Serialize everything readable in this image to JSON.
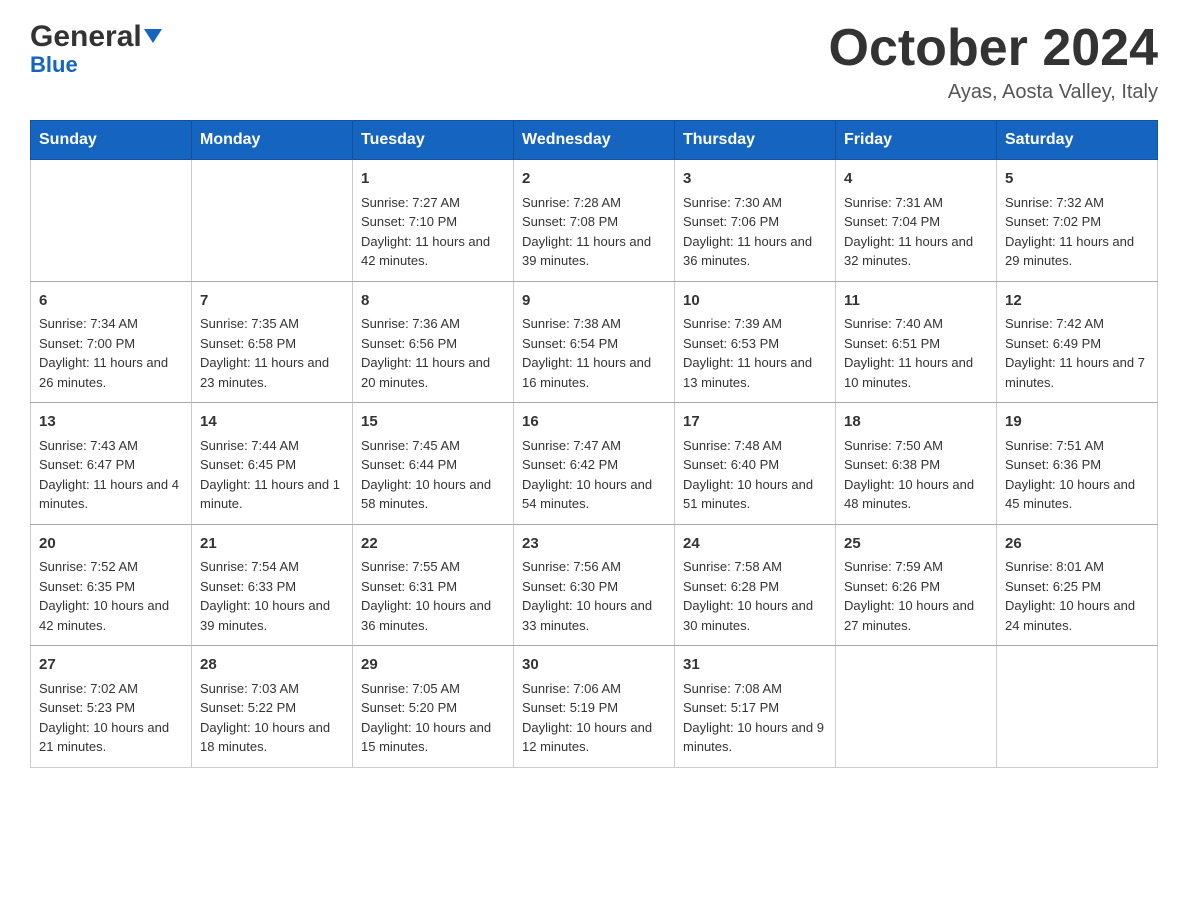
{
  "header": {
    "logo_general": "General",
    "logo_blue": "Blue",
    "month_year": "October 2024",
    "location": "Ayas, Aosta Valley, Italy"
  },
  "days_of_week": [
    "Sunday",
    "Monday",
    "Tuesday",
    "Wednesday",
    "Thursday",
    "Friday",
    "Saturday"
  ],
  "weeks": [
    [
      {
        "day": "",
        "sunrise": "",
        "sunset": "",
        "daylight": ""
      },
      {
        "day": "",
        "sunrise": "",
        "sunset": "",
        "daylight": ""
      },
      {
        "day": "1",
        "sunrise": "Sunrise: 7:27 AM",
        "sunset": "Sunset: 7:10 PM",
        "daylight": "Daylight: 11 hours and 42 minutes."
      },
      {
        "day": "2",
        "sunrise": "Sunrise: 7:28 AM",
        "sunset": "Sunset: 7:08 PM",
        "daylight": "Daylight: 11 hours and 39 minutes."
      },
      {
        "day": "3",
        "sunrise": "Sunrise: 7:30 AM",
        "sunset": "Sunset: 7:06 PM",
        "daylight": "Daylight: 11 hours and 36 minutes."
      },
      {
        "day": "4",
        "sunrise": "Sunrise: 7:31 AM",
        "sunset": "Sunset: 7:04 PM",
        "daylight": "Daylight: 11 hours and 32 minutes."
      },
      {
        "day": "5",
        "sunrise": "Sunrise: 7:32 AM",
        "sunset": "Sunset: 7:02 PM",
        "daylight": "Daylight: 11 hours and 29 minutes."
      }
    ],
    [
      {
        "day": "6",
        "sunrise": "Sunrise: 7:34 AM",
        "sunset": "Sunset: 7:00 PM",
        "daylight": "Daylight: 11 hours and 26 minutes."
      },
      {
        "day": "7",
        "sunrise": "Sunrise: 7:35 AM",
        "sunset": "Sunset: 6:58 PM",
        "daylight": "Daylight: 11 hours and 23 minutes."
      },
      {
        "day": "8",
        "sunrise": "Sunrise: 7:36 AM",
        "sunset": "Sunset: 6:56 PM",
        "daylight": "Daylight: 11 hours and 20 minutes."
      },
      {
        "day": "9",
        "sunrise": "Sunrise: 7:38 AM",
        "sunset": "Sunset: 6:54 PM",
        "daylight": "Daylight: 11 hours and 16 minutes."
      },
      {
        "day": "10",
        "sunrise": "Sunrise: 7:39 AM",
        "sunset": "Sunset: 6:53 PM",
        "daylight": "Daylight: 11 hours and 13 minutes."
      },
      {
        "day": "11",
        "sunrise": "Sunrise: 7:40 AM",
        "sunset": "Sunset: 6:51 PM",
        "daylight": "Daylight: 11 hours and 10 minutes."
      },
      {
        "day": "12",
        "sunrise": "Sunrise: 7:42 AM",
        "sunset": "Sunset: 6:49 PM",
        "daylight": "Daylight: 11 hours and 7 minutes."
      }
    ],
    [
      {
        "day": "13",
        "sunrise": "Sunrise: 7:43 AM",
        "sunset": "Sunset: 6:47 PM",
        "daylight": "Daylight: 11 hours and 4 minutes."
      },
      {
        "day": "14",
        "sunrise": "Sunrise: 7:44 AM",
        "sunset": "Sunset: 6:45 PM",
        "daylight": "Daylight: 11 hours and 1 minute."
      },
      {
        "day": "15",
        "sunrise": "Sunrise: 7:45 AM",
        "sunset": "Sunset: 6:44 PM",
        "daylight": "Daylight: 10 hours and 58 minutes."
      },
      {
        "day": "16",
        "sunrise": "Sunrise: 7:47 AM",
        "sunset": "Sunset: 6:42 PM",
        "daylight": "Daylight: 10 hours and 54 minutes."
      },
      {
        "day": "17",
        "sunrise": "Sunrise: 7:48 AM",
        "sunset": "Sunset: 6:40 PM",
        "daylight": "Daylight: 10 hours and 51 minutes."
      },
      {
        "day": "18",
        "sunrise": "Sunrise: 7:50 AM",
        "sunset": "Sunset: 6:38 PM",
        "daylight": "Daylight: 10 hours and 48 minutes."
      },
      {
        "day": "19",
        "sunrise": "Sunrise: 7:51 AM",
        "sunset": "Sunset: 6:36 PM",
        "daylight": "Daylight: 10 hours and 45 minutes."
      }
    ],
    [
      {
        "day": "20",
        "sunrise": "Sunrise: 7:52 AM",
        "sunset": "Sunset: 6:35 PM",
        "daylight": "Daylight: 10 hours and 42 minutes."
      },
      {
        "day": "21",
        "sunrise": "Sunrise: 7:54 AM",
        "sunset": "Sunset: 6:33 PM",
        "daylight": "Daylight: 10 hours and 39 minutes."
      },
      {
        "day": "22",
        "sunrise": "Sunrise: 7:55 AM",
        "sunset": "Sunset: 6:31 PM",
        "daylight": "Daylight: 10 hours and 36 minutes."
      },
      {
        "day": "23",
        "sunrise": "Sunrise: 7:56 AM",
        "sunset": "Sunset: 6:30 PM",
        "daylight": "Daylight: 10 hours and 33 minutes."
      },
      {
        "day": "24",
        "sunrise": "Sunrise: 7:58 AM",
        "sunset": "Sunset: 6:28 PM",
        "daylight": "Daylight: 10 hours and 30 minutes."
      },
      {
        "day": "25",
        "sunrise": "Sunrise: 7:59 AM",
        "sunset": "Sunset: 6:26 PM",
        "daylight": "Daylight: 10 hours and 27 minutes."
      },
      {
        "day": "26",
        "sunrise": "Sunrise: 8:01 AM",
        "sunset": "Sunset: 6:25 PM",
        "daylight": "Daylight: 10 hours and 24 minutes."
      }
    ],
    [
      {
        "day": "27",
        "sunrise": "Sunrise: 7:02 AM",
        "sunset": "Sunset: 5:23 PM",
        "daylight": "Daylight: 10 hours and 21 minutes."
      },
      {
        "day": "28",
        "sunrise": "Sunrise: 7:03 AM",
        "sunset": "Sunset: 5:22 PM",
        "daylight": "Daylight: 10 hours and 18 minutes."
      },
      {
        "day": "29",
        "sunrise": "Sunrise: 7:05 AM",
        "sunset": "Sunset: 5:20 PM",
        "daylight": "Daylight: 10 hours and 15 minutes."
      },
      {
        "day": "30",
        "sunrise": "Sunrise: 7:06 AM",
        "sunset": "Sunset: 5:19 PM",
        "daylight": "Daylight: 10 hours and 12 minutes."
      },
      {
        "day": "31",
        "sunrise": "Sunrise: 7:08 AM",
        "sunset": "Sunset: 5:17 PM",
        "daylight": "Daylight: 10 hours and 9 minutes."
      },
      {
        "day": "",
        "sunrise": "",
        "sunset": "",
        "daylight": ""
      },
      {
        "day": "",
        "sunrise": "",
        "sunset": "",
        "daylight": ""
      }
    ]
  ]
}
